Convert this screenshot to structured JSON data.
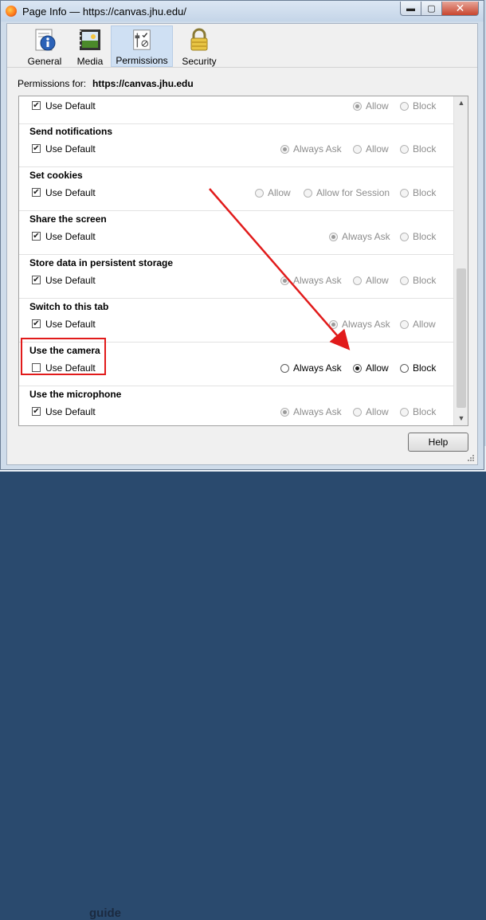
{
  "window": {
    "title": "Page Info — https://canvas.jhu.edu/",
    "minimize_glyph": "▬",
    "maximize_glyph": "▢",
    "close_glyph": "✕"
  },
  "background": {
    "peek_text": "guide"
  },
  "tabs": [
    {
      "label": "General",
      "icon": "info-icon",
      "active": false
    },
    {
      "label": "Media",
      "icon": "media-icon",
      "active": false
    },
    {
      "label": "Permissions",
      "icon": "permissions-icon",
      "active": true
    },
    {
      "label": "Security",
      "icon": "lock-icon",
      "active": false
    }
  ],
  "permissions_for": {
    "label": "Permissions for:",
    "site": "https://canvas.jhu.edu"
  },
  "permissions": [
    {
      "title": "",
      "use_default": "Use Default",
      "checked": true,
      "options": [
        {
          "label": "Allow",
          "selected": true
        },
        {
          "label": "Block",
          "selected": false
        }
      ],
      "enabled": false
    },
    {
      "title": "Send notifications",
      "use_default": "Use Default",
      "checked": true,
      "options": [
        {
          "label": "Always Ask",
          "selected": true
        },
        {
          "label": "Allow",
          "selected": false
        },
        {
          "label": "Block",
          "selected": false
        }
      ],
      "enabled": false
    },
    {
      "title": "Set cookies",
      "use_default": "Use Default",
      "checked": true,
      "options": [
        {
          "label": "Allow",
          "selected": false
        },
        {
          "label": "Allow for Session",
          "selected": false
        },
        {
          "label": "Block",
          "selected": false
        }
      ],
      "enabled": false
    },
    {
      "title": "Share the screen",
      "use_default": "Use Default",
      "checked": true,
      "options": [
        {
          "label": "Always Ask",
          "selected": true
        },
        {
          "label": "Block",
          "selected": false
        }
      ],
      "enabled": false
    },
    {
      "title": "Store data in persistent storage",
      "use_default": "Use Default",
      "checked": true,
      "options": [
        {
          "label": "Always Ask",
          "selected": true
        },
        {
          "label": "Allow",
          "selected": false
        },
        {
          "label": "Block",
          "selected": false
        }
      ],
      "enabled": false
    },
    {
      "title": "Switch to this tab",
      "use_default": "Use Default",
      "checked": true,
      "options": [
        {
          "label": "Always Ask",
          "selected": true
        },
        {
          "label": "Allow",
          "selected": false
        }
      ],
      "enabled": false
    },
    {
      "title": "Use the camera",
      "use_default": "Use Default",
      "checked": false,
      "options": [
        {
          "label": "Always Ask",
          "selected": false
        },
        {
          "label": "Allow",
          "selected": true
        },
        {
          "label": "Block",
          "selected": false
        }
      ],
      "enabled": true
    },
    {
      "title": "Use the microphone",
      "use_default": "Use Default",
      "checked": true,
      "options": [
        {
          "label": "Always Ask",
          "selected": true
        },
        {
          "label": "Allow",
          "selected": false
        },
        {
          "label": "Block",
          "selected": false
        }
      ],
      "enabled": false
    }
  ],
  "scrollbar": {
    "up_glyph": "▲",
    "down_glyph": "▼"
  },
  "help_label": "Help",
  "colors": {
    "annotation": "#e11b1b",
    "active_tab": "#cfe0f3"
  }
}
